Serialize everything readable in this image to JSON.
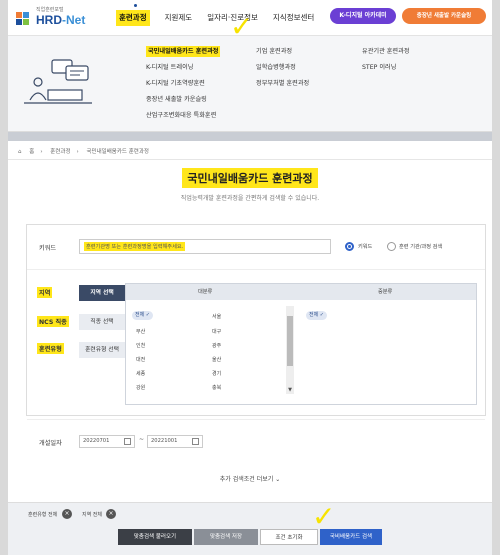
{
  "header": {
    "logo_tag": "직업훈련포털",
    "logo_name": "HRD",
    "logo_name_suffix": "-Net",
    "gnb": [
      "훈련과정",
      "지원제도",
      "일자리·진로정보",
      "지식정보센터"
    ],
    "k_digital": "K-디지털 아카데미",
    "k_digital_badge": "K-디지털",
    "promo": "충장년 새출발 카운슬링"
  },
  "mega": {
    "col1": [
      "국민내일배움카드 훈련과정",
      "K-디지털 트레이닝",
      "K-디지털 기초역량훈련",
      "중장년 새출발 카운슬링",
      "산업구조변화대응 특화훈련"
    ],
    "col2": [
      "기업 훈련과정",
      "일학습병행과정",
      "정부부처별 훈련과정"
    ],
    "col3": [
      "유관기관 훈련과정",
      "STEP 이러닝"
    ]
  },
  "breadcrumb": [
    "홈",
    "훈련과정",
    "국민내일배움카드 훈련과정"
  ],
  "page": {
    "title": "국민내일배움카드 훈련과정",
    "subtitle": "직업능력개발 훈련과정을 간편하게 검색할 수 있습니다."
  },
  "search": {
    "keyword_label": "키워드",
    "keyword_placeholder": "훈련기관명 또는 훈련과정명을 입력해주세요.",
    "radio_keyword": "키워드",
    "radio_institution": "훈련 기관/과정 검색",
    "region_label": "지역",
    "ncs_label": "NCS 직종",
    "type_label": "훈련유형",
    "tab_region": "지역 선택",
    "tab_ncs": "직종 선택",
    "tab_type": "훈련유형 선택",
    "panel_head_left": "대분류",
    "panel_head_right": "중분류",
    "regions_col1": [
      "전체",
      "부산",
      "인천",
      "대전",
      "세종",
      "강원"
    ],
    "regions_col2": [
      "서울",
      "대구",
      "광주",
      "울산",
      "경기",
      "충북"
    ],
    "selected_chip": "전체",
    "date_label": "개설일자",
    "date_from": "20220701",
    "date_to": "20221001",
    "date_sep": "~",
    "more_conditions": "추가 검색조건 더보기"
  },
  "bottom": {
    "chip1": "훈련유형 전체",
    "chip2": "지역 전체",
    "btn_load": "맞춤검색 불러오기",
    "btn_save": "맞춤검색 저장",
    "btn_reset": "조건 초기화",
    "btn_search": "국비배움카드 검색"
  }
}
